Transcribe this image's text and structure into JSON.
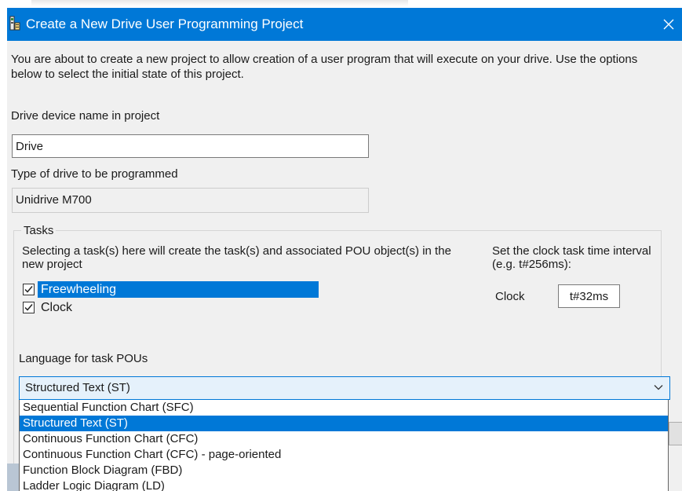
{
  "window": {
    "title": "Create a New Drive User Programming Project",
    "close_glyph": "✕",
    "icons": {
      "app": "app-icon",
      "close": "close-icon"
    }
  },
  "intro": {
    "text": "You are about to create a new project to allow creation of a user program that will execute on your drive.  Use the options below to select the initial state of this project."
  },
  "device": {
    "label": "Drive device name in project",
    "value": "Drive"
  },
  "drive_type": {
    "label": "Type of drive to be programmed",
    "value": "Unidrive M700"
  },
  "tasks": {
    "legend": "Tasks",
    "description": "Selecting a task(s) here will create the task(s) and associated POU object(s) in the new project",
    "items": [
      {
        "label": "Freewheeling",
        "checked": true,
        "selected": true
      },
      {
        "label": "Clock",
        "checked": true,
        "selected": false
      }
    ],
    "clock_description": "Set the clock task time interval (e.g. t#256ms):",
    "clock_label": "Clock",
    "clock_value": "t#32ms"
  },
  "language": {
    "label": "Language for task POUs",
    "selected": "Structured Text (ST)",
    "options": [
      "Sequential Function Chart (SFC)",
      "Structured Text (ST)",
      "Continuous Function Chart (CFC)",
      "Continuous Function Chart (CFC) - page-oriented",
      "Function Block Diagram (FBD)",
      "Ladder Logic Diagram (LD)"
    ],
    "highlighted_index": 1
  },
  "colors": {
    "accent": "#0078d7",
    "dialog_bg": "#f0f0f0"
  }
}
